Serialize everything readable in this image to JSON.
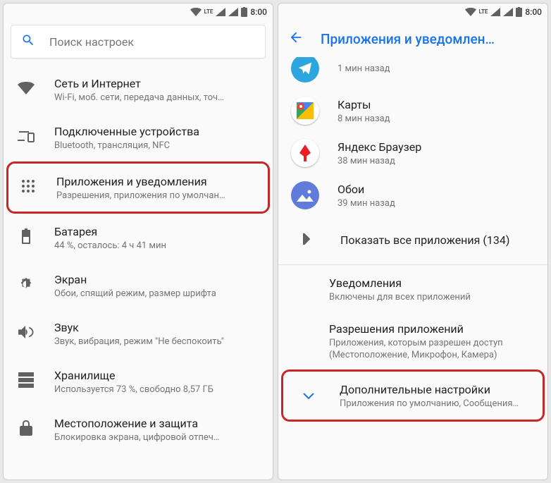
{
  "status": {
    "time": "8:00",
    "lte": "LTE"
  },
  "left": {
    "search_placeholder": "Поиск настроек",
    "items": [
      {
        "title": "Сеть и Интернет",
        "sub": "Wi-Fi, моб. сети, передача данных, точ…"
      },
      {
        "title": "Подключенные устройства",
        "sub": "Bluetooth, трансляция, NFC"
      },
      {
        "title": "Приложения и уведомления",
        "sub": "Разрешения, приложения по умолчан…"
      },
      {
        "title": "Батарея",
        "sub": "44 %, осталось: 4 ч 41 мин"
      },
      {
        "title": "Экран",
        "sub": "Обои, спящий режим, размер шрифта"
      },
      {
        "title": "Звук",
        "sub": "Звук, вибрация, режим \"Не беспокоить\""
      },
      {
        "title": "Хранилище",
        "sub": "Используется 73 %, свободно 8,57 ГБ"
      },
      {
        "title": "Местоположение и защита",
        "sub": "Блокировка экрана, цифровой отпеч…"
      }
    ]
  },
  "right": {
    "title": "Приложения и уведомлен…",
    "apps": [
      {
        "name": "",
        "sub": "1 мин назад"
      },
      {
        "name": "Карты",
        "sub": "8 мин назад"
      },
      {
        "name": "Яндекс Браузер",
        "sub": "38 мин назад"
      },
      {
        "name": "Обои",
        "sub": "39 мин назад"
      }
    ],
    "show_all": "Показать все приложения (134)",
    "sections": [
      {
        "title": "Уведомления",
        "sub": "Включены для всех приложений"
      },
      {
        "title": "Разрешения приложений",
        "sub": "Приложения, которым разрешен доступ (Местоположение, Микрофон, Камера)"
      },
      {
        "title": "Дополнительные настройки",
        "sub": "Приложения по умолчанию, Сообщения…"
      }
    ]
  }
}
